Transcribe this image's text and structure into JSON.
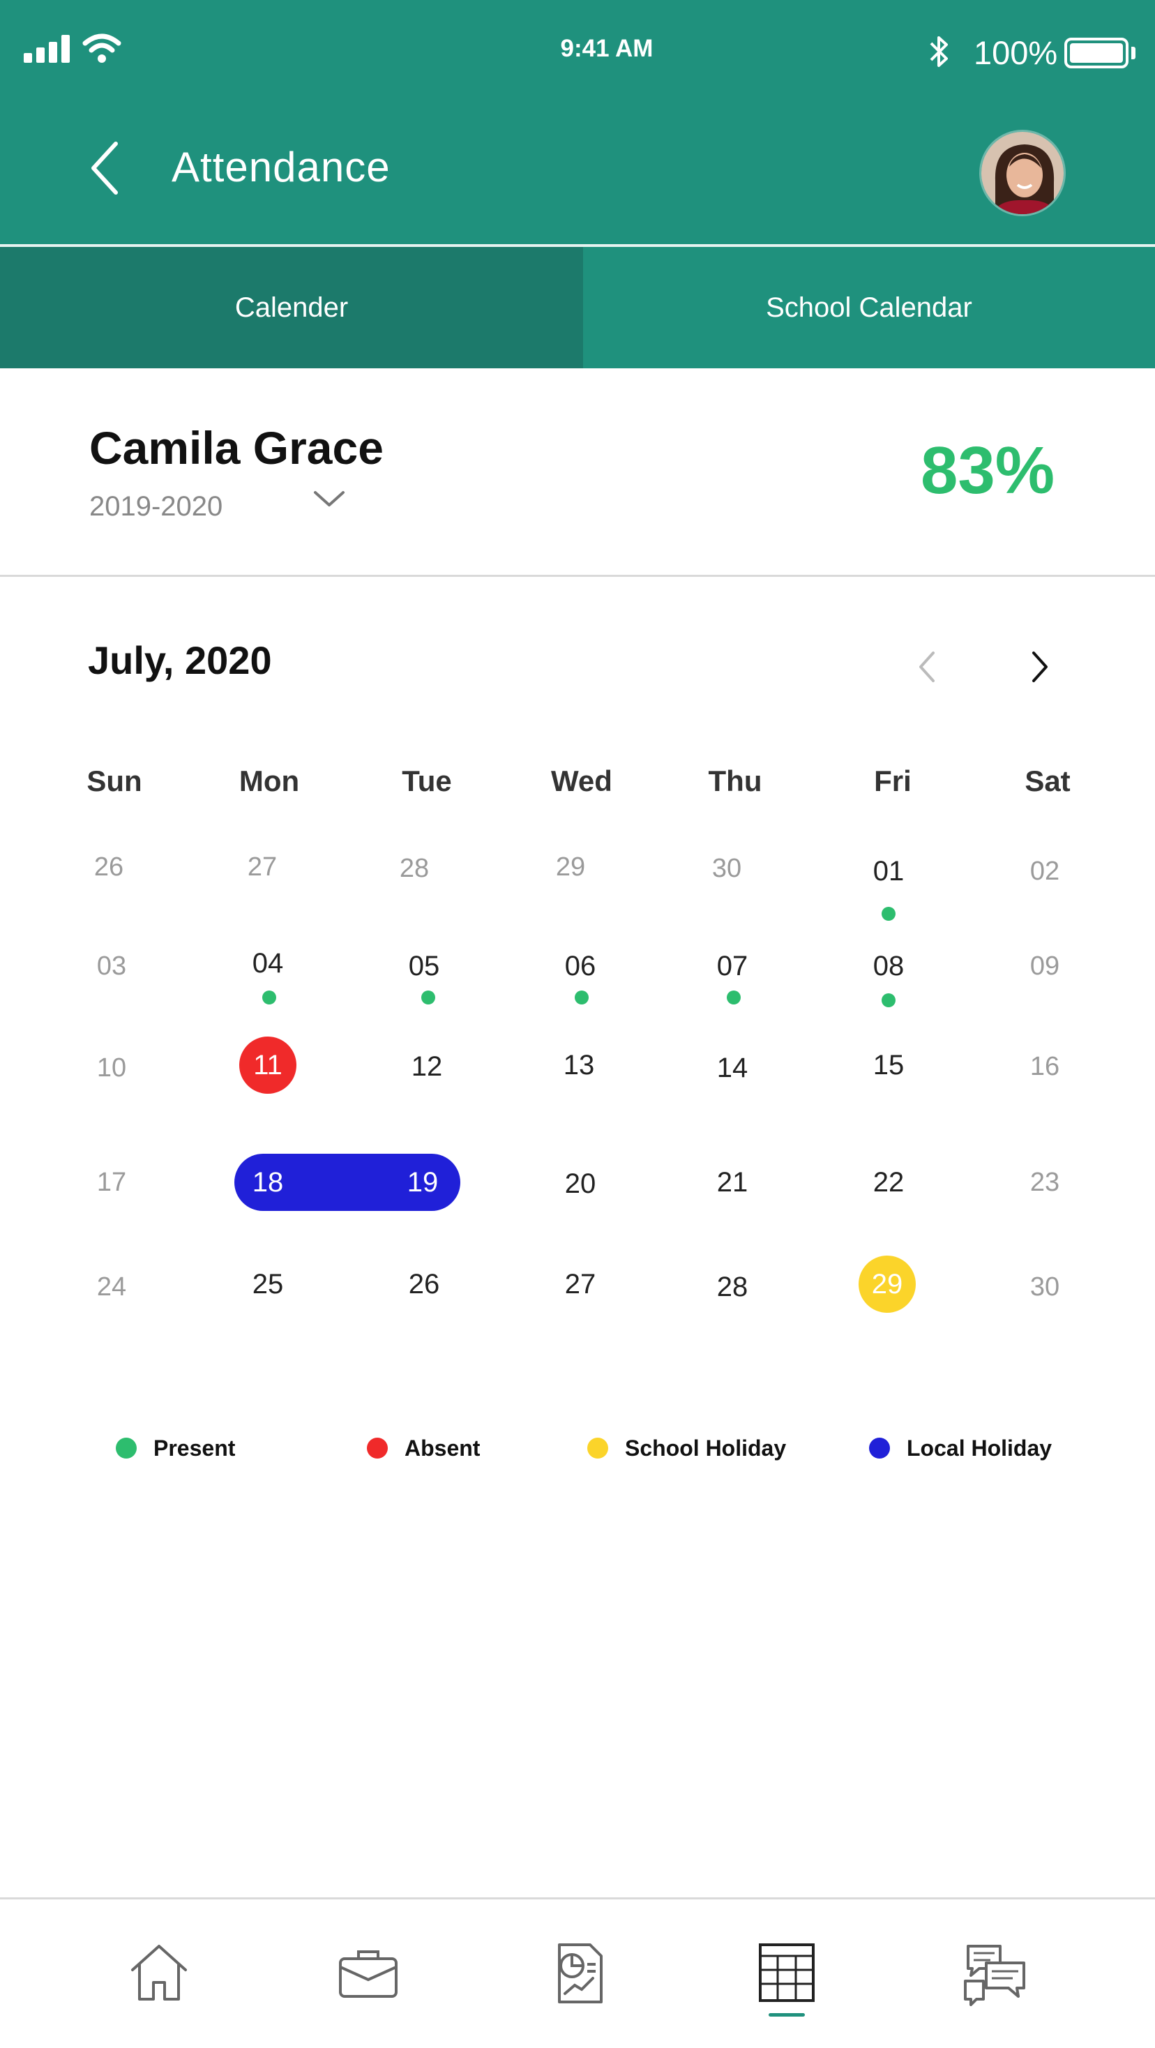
{
  "status_bar": {
    "time": "9:41 AM",
    "battery": "100%"
  },
  "header": {
    "title": "Attendance"
  },
  "tabs": [
    {
      "label": "Calender"
    },
    {
      "label": "School Calendar"
    }
  ],
  "student": {
    "name": "Camila Grace",
    "year": "2019-2020",
    "attendance_percent": "83%"
  },
  "calendar": {
    "month_label": "July, 2020",
    "weekdays": [
      "Sun",
      "Mon",
      "Tue",
      "Wed",
      "Thu",
      "Fri",
      "Sat"
    ],
    "weeks": [
      [
        "26",
        "27",
        "28",
        "29",
        "30",
        "01",
        "02"
      ],
      [
        "03",
        "04",
        "05",
        "06",
        "07",
        "08",
        "09"
      ],
      [
        "10",
        "11",
        "12",
        "13",
        "14",
        "15",
        "16"
      ],
      [
        "17",
        "18",
        "19",
        "20",
        "21",
        "22",
        "23"
      ],
      [
        "24",
        "25",
        "26",
        "27",
        "28",
        "29",
        "30"
      ]
    ]
  },
  "legend": [
    {
      "label": "Present",
      "color": "#2dbd6e"
    },
    {
      "label": "Absent",
      "color": "#f02a2a"
    },
    {
      "label": "School Holiday",
      "color": "#fbd42a"
    },
    {
      "label": "Local Holiday",
      "color": "#2020d8"
    }
  ],
  "bottom_nav": [
    {
      "icon": "home-icon"
    },
    {
      "icon": "briefcase-icon"
    },
    {
      "icon": "report-chart-icon"
    },
    {
      "icon": "calendar-grid-icon",
      "active": true
    },
    {
      "icon": "chat-icon"
    }
  ]
}
